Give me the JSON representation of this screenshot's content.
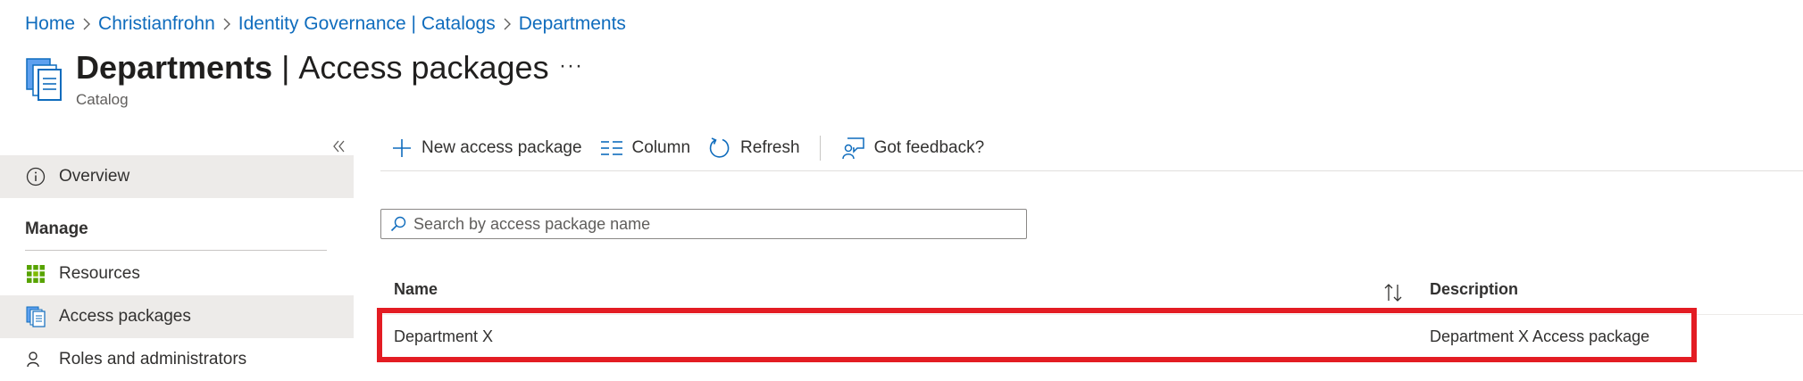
{
  "breadcrumb": [
    "Home",
    "Christianfrohn",
    "Identity Governance | Catalogs",
    "Departments"
  ],
  "header": {
    "title_bold": "Departments",
    "title_sep": "|",
    "title_rest": "Access packages",
    "more": "···",
    "subtitle": "Catalog"
  },
  "sidebar": {
    "overview": "Overview",
    "manage_heading": "Manage",
    "items": [
      {
        "label": "Resources",
        "icon": "grid-icon"
      },
      {
        "label": "Access packages",
        "icon": "access-package-icon"
      },
      {
        "label": "Roles and administrators",
        "icon": "person-key-icon"
      }
    ],
    "selected": "Access packages"
  },
  "toolbar": {
    "new_label": "New access package",
    "column_label": "Column",
    "refresh_label": "Refresh",
    "feedback_label": "Got feedback?"
  },
  "search": {
    "placeholder": "Search by access package name",
    "value": ""
  },
  "table": {
    "columns": [
      "Name",
      "Description"
    ],
    "rows": [
      {
        "name": "Department X",
        "description": "Department X Access package"
      }
    ]
  },
  "colors": {
    "link": "#0f6cbd",
    "highlight": "#e31c23",
    "selected_bg": "#edebe9"
  }
}
